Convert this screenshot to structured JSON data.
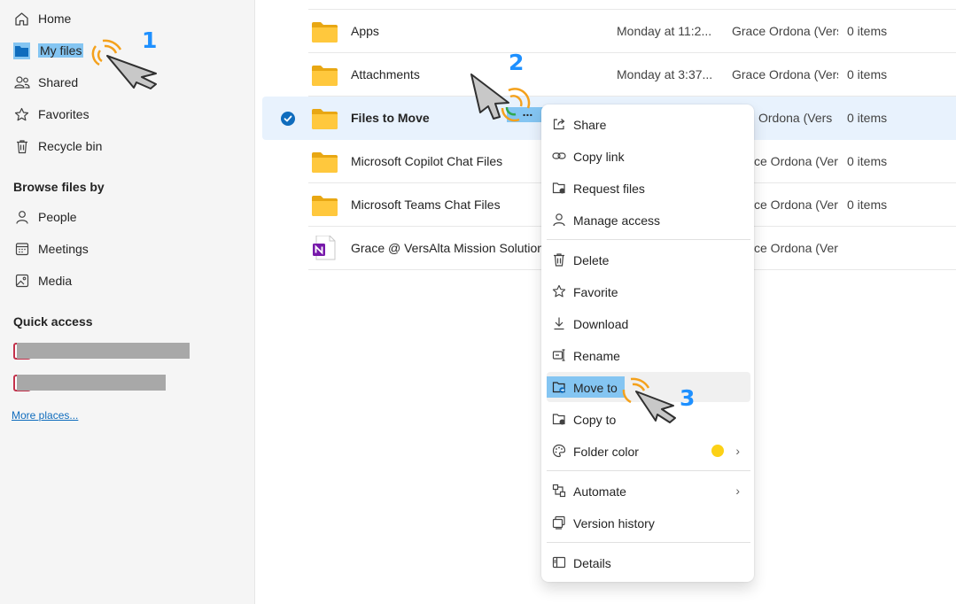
{
  "sidebar": {
    "nav": [
      {
        "label": "Home"
      },
      {
        "label": "My files"
      },
      {
        "label": "Shared"
      },
      {
        "label": "Favorites"
      },
      {
        "label": "Recycle bin"
      }
    ],
    "browse_title": "Browse files by",
    "browse": [
      {
        "label": "People"
      },
      {
        "label": "Meetings"
      },
      {
        "label": "Media"
      }
    ],
    "quick_access_title": "Quick access",
    "more_places": "More places..."
  },
  "files": [
    {
      "name": "Apps",
      "modified": "Monday at 11:2...",
      "owner": "Grace Ordona (Vers",
      "count": "0 items",
      "type": "folder"
    },
    {
      "name": "Attachments",
      "modified": "Monday at 3:37...",
      "owner": "Grace Ordona (Vers",
      "count": "0 items",
      "type": "folder"
    },
    {
      "name": "Files to Move",
      "modified": "",
      "owner": "Grace Ordona (Vers",
      "owner_partial": "Ordona (Vers",
      "count": "0 items",
      "type": "folder",
      "selected": true
    },
    {
      "name": "Microsoft Copilot Chat Files",
      "owner_partial": "ce Ordona (Vers",
      "count": "0 items",
      "type": "folder"
    },
    {
      "name": "Microsoft Teams Chat Files",
      "owner_partial": "ce Ordona (Vers",
      "count": "0 items",
      "type": "folder"
    },
    {
      "name": "Grace @ VersAlta Mission Solutions",
      "owner_partial": "ce Ordona (Vers",
      "count": "",
      "type": "onenote"
    }
  ],
  "more_button_label": "...",
  "context_menu": {
    "items": [
      {
        "label": "Share",
        "icon": "share-icon"
      },
      {
        "label": "Copy link",
        "icon": "link-icon"
      },
      {
        "label": "Request files",
        "icon": "request-files-icon"
      },
      {
        "label": "Manage access",
        "icon": "person-icon"
      },
      {
        "label": "Delete",
        "icon": "trash-icon"
      },
      {
        "label": "Favorite",
        "icon": "star-icon"
      },
      {
        "label": "Download",
        "icon": "download-icon"
      },
      {
        "label": "Rename",
        "icon": "rename-icon"
      },
      {
        "label": "Move to",
        "icon": "move-folder-icon"
      },
      {
        "label": "Copy to",
        "icon": "copy-icon"
      },
      {
        "label": "Folder color",
        "icon": "palette-icon"
      },
      {
        "label": "Automate",
        "icon": "automate-icon"
      },
      {
        "label": "Version history",
        "icon": "history-icon"
      },
      {
        "label": "Details",
        "icon": "details-icon"
      }
    ],
    "folder_color_swatch": "#fcd116"
  },
  "annotations": {
    "steps": [
      "1",
      "2",
      "3"
    ],
    "step_color": "#1e90ff",
    "highlight_color": "#84c5f2"
  }
}
